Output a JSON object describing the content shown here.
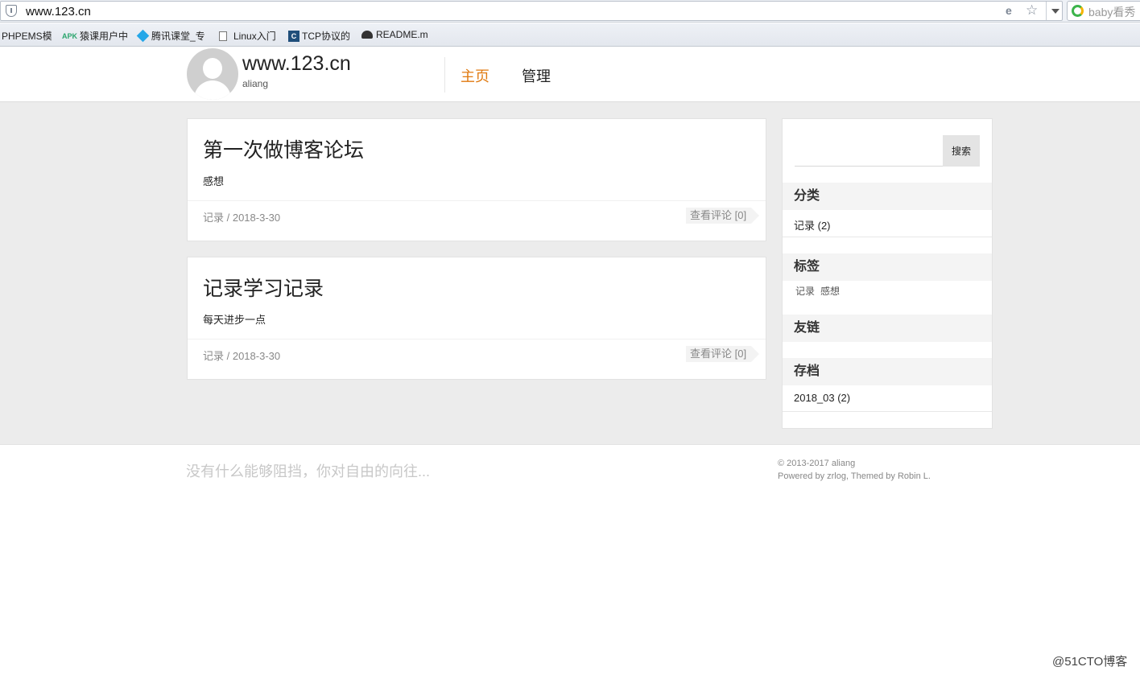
{
  "browser": {
    "url": "www.123.cn",
    "search_placeholder": "baby看秀",
    "bookmarks": [
      {
        "label": "PHPEMS模"
      },
      {
        "label": "猿课用户中"
      },
      {
        "label": "腾讯课堂_专"
      },
      {
        "label": "Linux入门"
      },
      {
        "label": "TCP协议的"
      },
      {
        "label": "README.m"
      }
    ],
    "apk_badge": "APK",
    "tcp_badge": "C"
  },
  "site": {
    "title": "www.123.cn",
    "subtitle": "aliang"
  },
  "nav": {
    "items": [
      {
        "label": "主页",
        "active": true
      },
      {
        "label": "管理",
        "active": false
      }
    ]
  },
  "posts": [
    {
      "title": "第一次做博客论坛",
      "excerpt": "感想",
      "meta": "记录 / 2018-3-30",
      "comments": "查看评论 [0]"
    },
    {
      "title": "记录学习记录",
      "excerpt": "每天进步一点",
      "meta": "记录 / 2018-3-30",
      "comments": "查看评论 [0]"
    }
  ],
  "sidebar": {
    "search_button": "搜索",
    "categories": {
      "heading": "分类",
      "items": [
        "记录 (2)"
      ]
    },
    "tags": {
      "heading": "标签",
      "items": [
        "记录",
        "感想"
      ]
    },
    "links": {
      "heading": "友链"
    },
    "archive": {
      "heading": "存档",
      "items": [
        "2018_03 (2)"
      ]
    }
  },
  "footer": {
    "motto": "没有什么能够阻挡，你对自由的向往...",
    "copyright": "© 2013-2017 aliang",
    "powered": "Powered by zrlog, Themed by Robin L."
  },
  "watermark": "@51CTO博客",
  "colors": {
    "accent": "#e07a10",
    "background": "#ececec"
  }
}
